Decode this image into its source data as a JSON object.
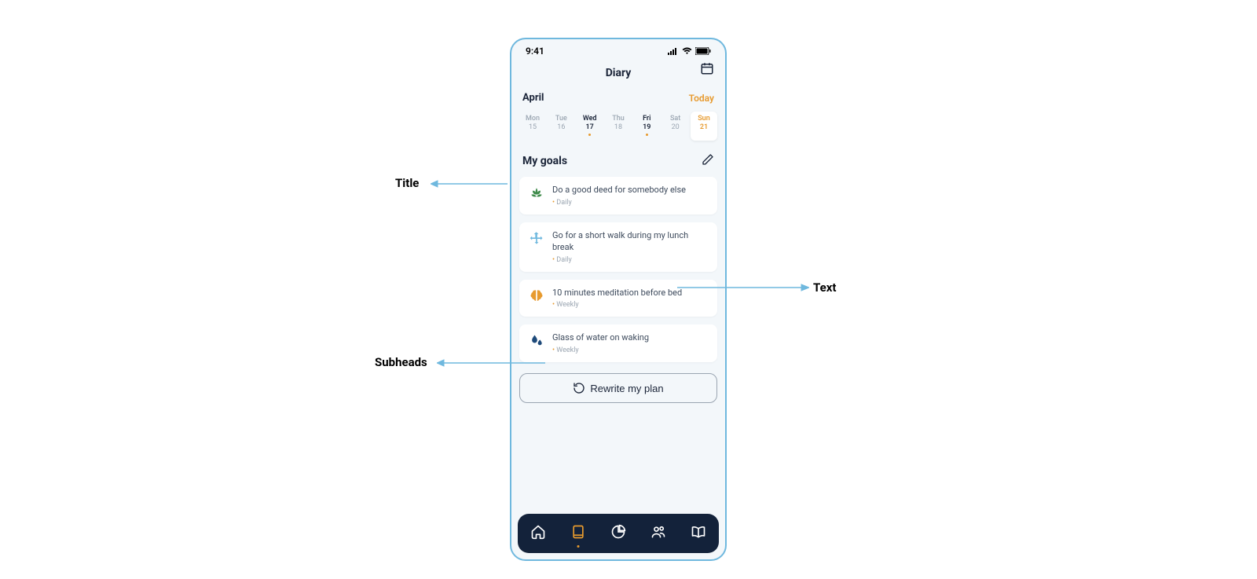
{
  "status": {
    "time": "9:41"
  },
  "header": {
    "title": "Diary"
  },
  "month": {
    "label": "April",
    "today_label": "Today"
  },
  "week": [
    {
      "name": "Mon",
      "num": "15",
      "style": "muted",
      "dot": false,
      "selected": false
    },
    {
      "name": "Tue",
      "num": "16",
      "style": "muted",
      "dot": false,
      "selected": false
    },
    {
      "name": "Wed",
      "num": "17",
      "style": "strong",
      "dot": true,
      "selected": false
    },
    {
      "name": "Thu",
      "num": "18",
      "style": "muted",
      "dot": false,
      "selected": false
    },
    {
      "name": "Fri",
      "num": "19",
      "style": "strong",
      "dot": true,
      "selected": false
    },
    {
      "name": "Sat",
      "num": "20",
      "style": "muted",
      "dot": false,
      "selected": false
    },
    {
      "name": "Sun",
      "num": "21",
      "style": "accent",
      "dot": false,
      "selected": true
    }
  ],
  "goals": {
    "section_title": "My goals",
    "items": [
      {
        "title": "Do a good deed for somebody else",
        "cadence": "Daily",
        "icon": "lotus-icon",
        "color": "#3e8a4a"
      },
      {
        "title": "Go for a short walk during my lunch break",
        "cadence": "Daily",
        "icon": "move-icon",
        "color": "#6fb8de"
      },
      {
        "title": "10 minutes meditation before bed",
        "cadence": "Weekly",
        "icon": "brain-icon",
        "color": "#e79a2e"
      },
      {
        "title": "Glass of water on waking",
        "cadence": "Weekly",
        "icon": "droplets-icon",
        "color": "#1e4a7a"
      }
    ]
  },
  "rewrite": {
    "label": "Rewrite my plan"
  },
  "nav": {
    "items": [
      {
        "name": "nav-home",
        "icon": "home-icon",
        "active": false
      },
      {
        "name": "nav-diary",
        "icon": "book-icon",
        "active": true
      },
      {
        "name": "nav-stats",
        "icon": "chart-icon",
        "active": false
      },
      {
        "name": "nav-people",
        "icon": "people-icon",
        "active": false
      },
      {
        "name": "nav-library",
        "icon": "open-book-icon",
        "active": false
      }
    ]
  },
  "annotations": {
    "title": "Title",
    "text": "Text",
    "subheads": "Subheads"
  }
}
